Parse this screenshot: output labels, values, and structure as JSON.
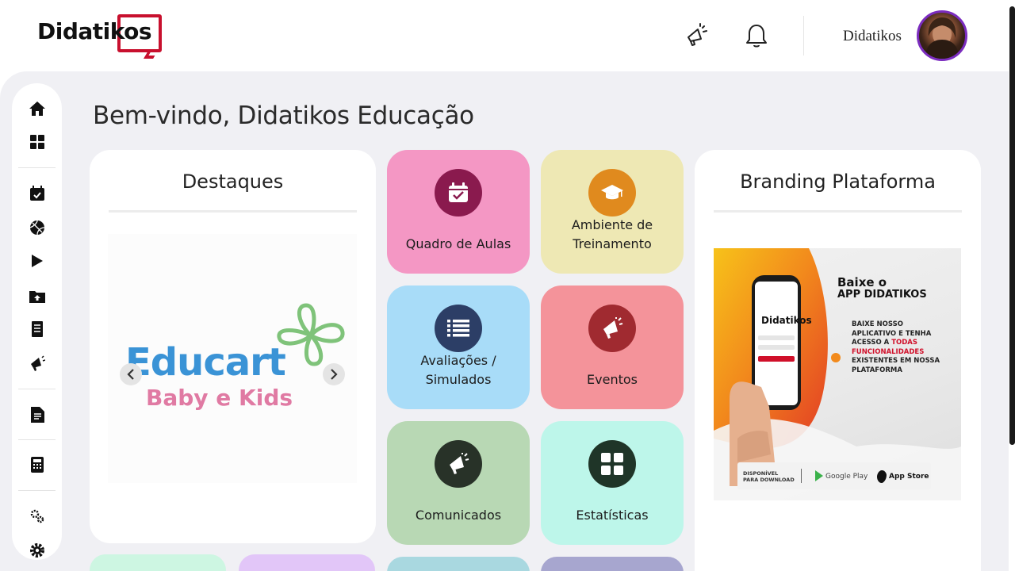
{
  "header": {
    "logo_text": "Didatikos",
    "user_name": "Didatikos"
  },
  "welcome": "Bem-vindo, Didatikos Educação",
  "highlights": {
    "title": "Destaques",
    "slide_main": "Educart",
    "slide_sub": "Baby e Kids"
  },
  "tiles": [
    {
      "label": "Quadro de Aulas",
      "icon": "calendar-check-icon",
      "bg": "#f497c4",
      "circle": "#8a1a4e"
    },
    {
      "label": "Ambiente de Treinamento",
      "icon": "graduation-cap-icon",
      "bg": "#eee8b4",
      "circle": "#e08a1e"
    },
    {
      "label": "Avaliações / Simulados",
      "icon": "list-icon",
      "bg": "#a8dcf8",
      "circle": "#2c3e66"
    },
    {
      "label": "Eventos",
      "icon": "megaphone-icon",
      "bg": "#f4939a",
      "circle": "#a02a30"
    },
    {
      "label": "Comunicados",
      "icon": "megaphone-icon",
      "bg": "#b8d8b4",
      "circle": "#283228"
    },
    {
      "label": "Estatísticas",
      "icon": "grid-icon",
      "bg": "#bdf6ea",
      "circle": "#1f3528"
    }
  ],
  "branding": {
    "title": "Branding Plataforma",
    "ad_heading_1": "Baixe o",
    "ad_heading_2": "APP DIDATIKOS",
    "ad_body_1": "BAIXE NOSSO",
    "ad_body_2": "APLICATIVO E TENHA",
    "ad_body_3": "ACESSO A",
    "ad_body_highlight": "TODAS",
    "ad_body_4": "FUNCIONALIDADES",
    "ad_body_5": "EXISTENTES EM NOSSA",
    "ad_body_6": "PLATAFORMA",
    "phone_logo": "Didatikos",
    "download_1": "DISPONÍVEL",
    "download_2": "PARA DOWNLOAD",
    "google_play": "Google Play",
    "app_store": "App Store"
  },
  "colors": {
    "accent": "#c8102e",
    "avatar_ring": "#7b2cbf",
    "background": "#f0f0f4"
  }
}
